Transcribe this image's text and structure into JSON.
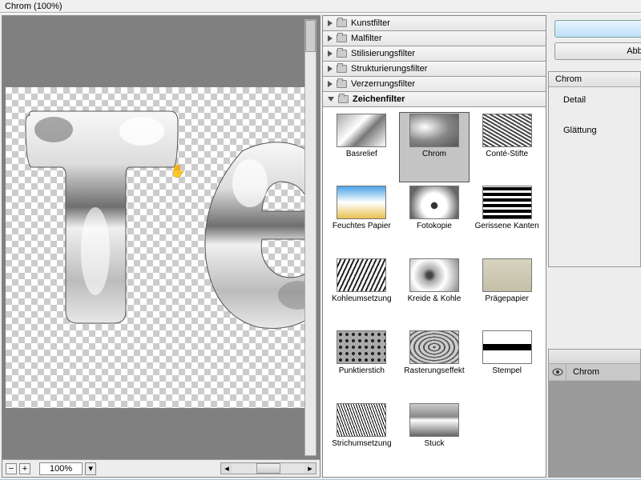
{
  "window": {
    "title": "Chrom (100%)"
  },
  "zoom": {
    "level": "100%"
  },
  "categories": [
    {
      "label": "Kunstfilter",
      "expanded": false
    },
    {
      "label": "Malfilter",
      "expanded": false
    },
    {
      "label": "Stilisierungsfilter",
      "expanded": false
    },
    {
      "label": "Strukturierungsfilter",
      "expanded": false
    },
    {
      "label": "Verzerrungsfilter",
      "expanded": false
    },
    {
      "label": "Zeichenfilter",
      "expanded": true
    }
  ],
  "filters": [
    {
      "label": "Basrelief",
      "selected": false,
      "tex": "t0"
    },
    {
      "label": "Chrom",
      "selected": true,
      "tex": "t1"
    },
    {
      "label": "Conté-Stifte",
      "selected": false,
      "tex": "t2"
    },
    {
      "label": "Feuchtes Papier",
      "selected": false,
      "tex": "t3"
    },
    {
      "label": "Fotokopie",
      "selected": false,
      "tex": "t4"
    },
    {
      "label": "Gerissene Kanten",
      "selected": false,
      "tex": "t5"
    },
    {
      "label": "Kohleumsetzung",
      "selected": false,
      "tex": "t6"
    },
    {
      "label": "Kreide & Kohle",
      "selected": false,
      "tex": "t7"
    },
    {
      "label": "Prägepapier",
      "selected": false,
      "tex": "t8"
    },
    {
      "label": "Punktierstich",
      "selected": false,
      "tex": "t9"
    },
    {
      "label": "Rasterungseffekt",
      "selected": false,
      "tex": "t10"
    },
    {
      "label": "Stempel",
      "selected": false,
      "tex": "t11"
    },
    {
      "label": "Strichumsetzung",
      "selected": false,
      "tex": "t12"
    },
    {
      "label": "Stuck",
      "selected": false,
      "tex": "t13"
    }
  ],
  "actions": {
    "ok": "",
    "cancel": "Abb"
  },
  "params": {
    "title": "Chrom",
    "detail_label": "Detail",
    "smooth_label": "Glättung"
  },
  "layers": {
    "eye_icon": "eye-icon",
    "name": "Chrom"
  }
}
